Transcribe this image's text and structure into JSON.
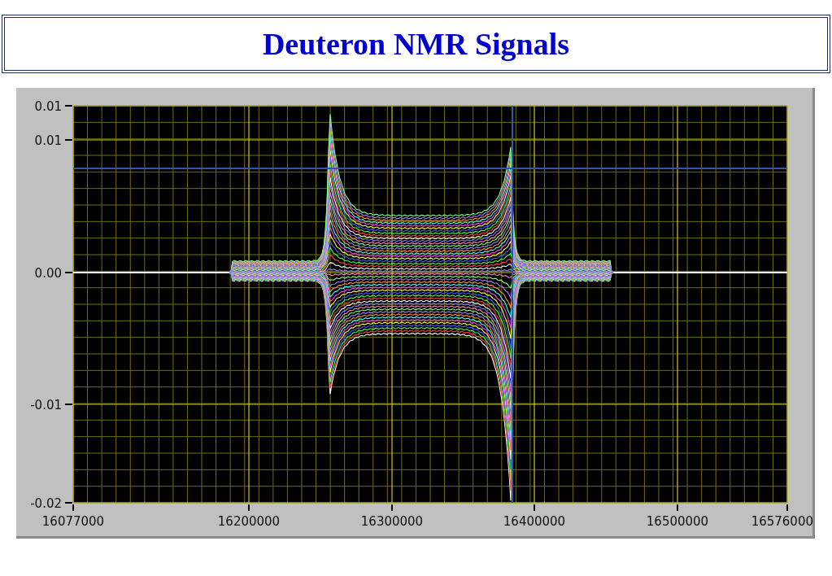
{
  "title": "Deuteron NMR Signals",
  "graph": {
    "y_tick_labels": [
      "0.01",
      "0.01",
      "0.00",
      "-0.01",
      "-0.02"
    ],
    "x_tick_labels": [
      "16077000",
      "16200000",
      "16300000",
      "16400000",
      "16500000",
      "16576000"
    ]
  }
}
